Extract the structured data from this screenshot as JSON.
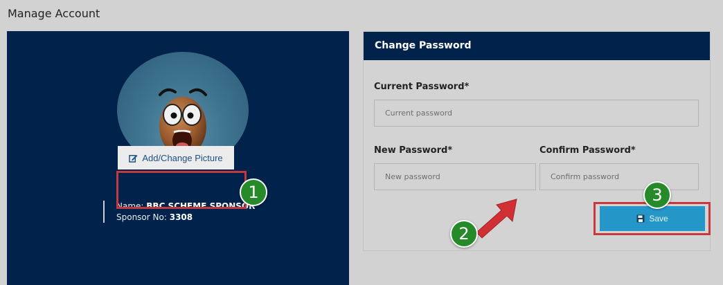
{
  "page": {
    "title": "Manage Account"
  },
  "profile": {
    "avatar_icon": "shocked-emoji-avatar",
    "add_picture_label": "Add/Change Picture",
    "name_label": "Name:",
    "name_value": "BBC SCHEME SPONSOR",
    "sponsor_label": "Sponsor No:",
    "sponsor_value": "3308"
  },
  "change_password": {
    "title": "Change Password",
    "current": {
      "label": "Current Password*",
      "placeholder": "Current password",
      "value": ""
    },
    "new": {
      "label": "New Password*",
      "placeholder": "New password",
      "value": ""
    },
    "confirm": {
      "label": "Confirm Password*",
      "placeholder": "Confirm password",
      "value": ""
    },
    "save_label": "Save"
  },
  "annotations": {
    "steps": [
      "1",
      "2",
      "3"
    ],
    "highlight_color": "#c5383e",
    "badge_color": "#268a2a",
    "arrow_color": "#d03034"
  },
  "colors": {
    "navy": "#01224a",
    "save_button": "#2596c8",
    "background": "#d2d2d2"
  }
}
